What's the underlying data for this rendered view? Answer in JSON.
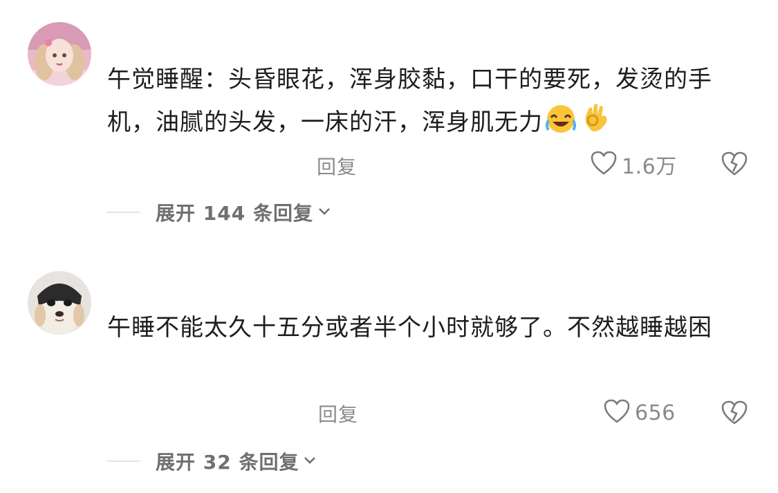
{
  "comments": [
    {
      "avatar_icon": "user-avatar-doll-girl",
      "text": "午觉睡醒：头昏眼花，浑身胶黏，口干的要死，发烫的手机，油腻的头发，一床的汗，浑身肌无力",
      "emoji": [
        "rolling-on-floor-laughing-emoji",
        "ok-hand-emoji"
      ],
      "reply_label": "回复",
      "like_count": "1.6万",
      "expand_label": "展开 144 条回复"
    },
    {
      "avatar_icon": "user-avatar-dog",
      "text": "午睡不能太久十五分或者半个小时就够了。不然越睡越困",
      "reply_label": "回复",
      "like_count": "656",
      "expand_label": "展开 32 条回复"
    }
  ],
  "colors": {
    "text": "#1d1d1f",
    "muted": "#8a8a8a",
    "divider": "#e4e4e4",
    "background": "#ffffff"
  }
}
